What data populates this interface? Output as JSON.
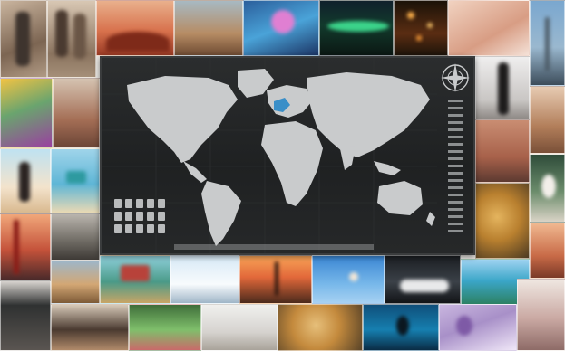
{
  "scene": {
    "type": "photo-collage wall with scratch-off world map poster",
    "colors": {
      "wall": "#e9e6e2",
      "poster_bg": "#222425",
      "land": "#c9cbcc",
      "highlight": "#3a8fc8"
    }
  },
  "poster": {
    "icons": [
      "compass-rose-icon",
      "landmark-icons"
    ]
  }
}
